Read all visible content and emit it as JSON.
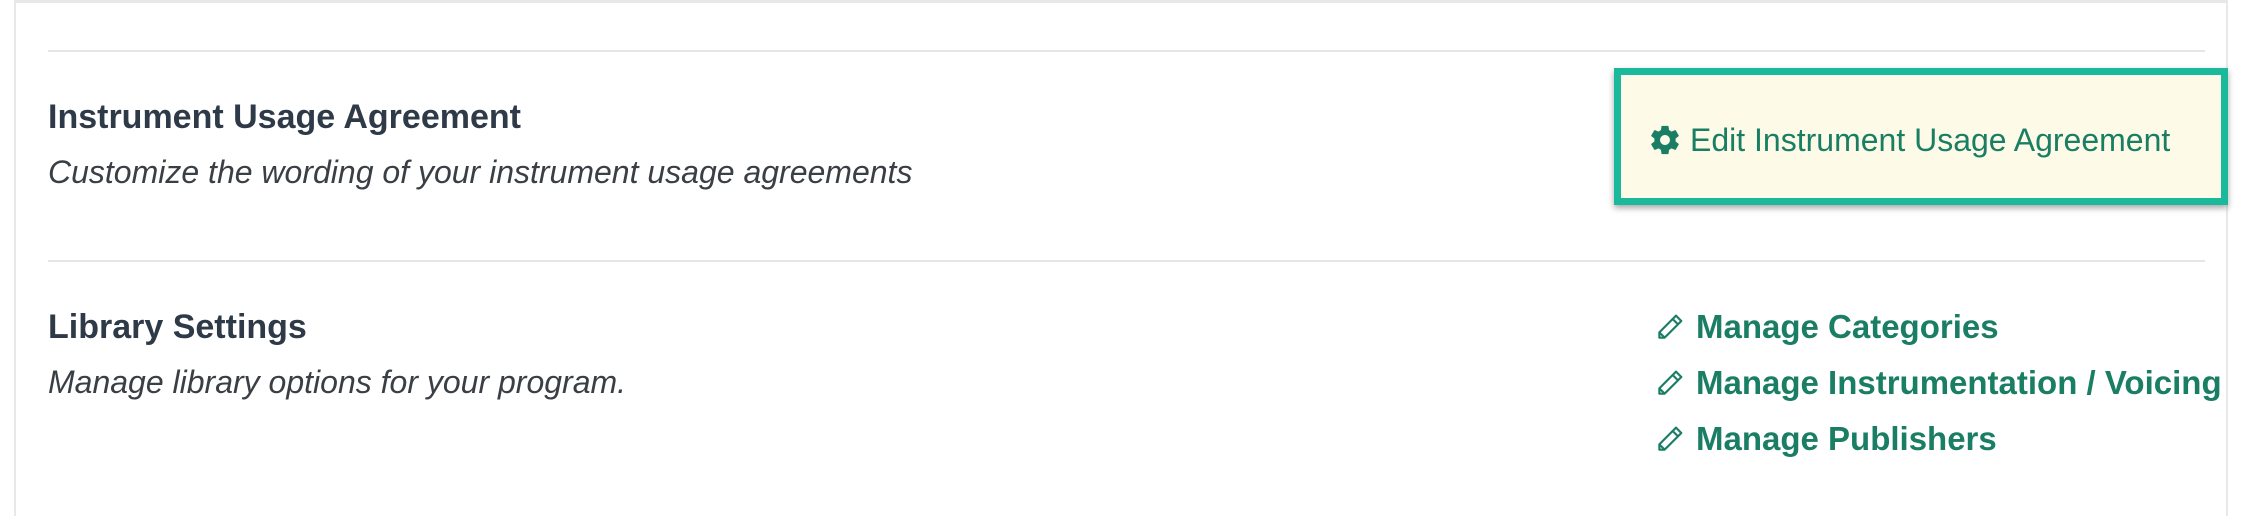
{
  "sections": [
    {
      "title": "Instrument Usage Agreement",
      "description": "Customize the wording of your instrument usage agreements",
      "action": {
        "icon": "gear-icon",
        "label": "Edit Instrument Usage Agreement"
      }
    },
    {
      "title": "Library Settings",
      "description": "Manage library options for your program.",
      "links": [
        {
          "icon": "pencil-icon",
          "label": "Manage Categories"
        },
        {
          "icon": "pencil-icon",
          "label": "Manage Instrumentation / Voicing"
        },
        {
          "icon": "pencil-icon",
          "label": "Manage Publishers"
        }
      ]
    }
  ],
  "colors": {
    "link": "#1a7e64",
    "highlight_border": "#1ab99c",
    "highlight_background": "#fdfbe7",
    "heading": "#2e3a48",
    "description": "#3a3f46",
    "divider": "#e4e7ea"
  }
}
